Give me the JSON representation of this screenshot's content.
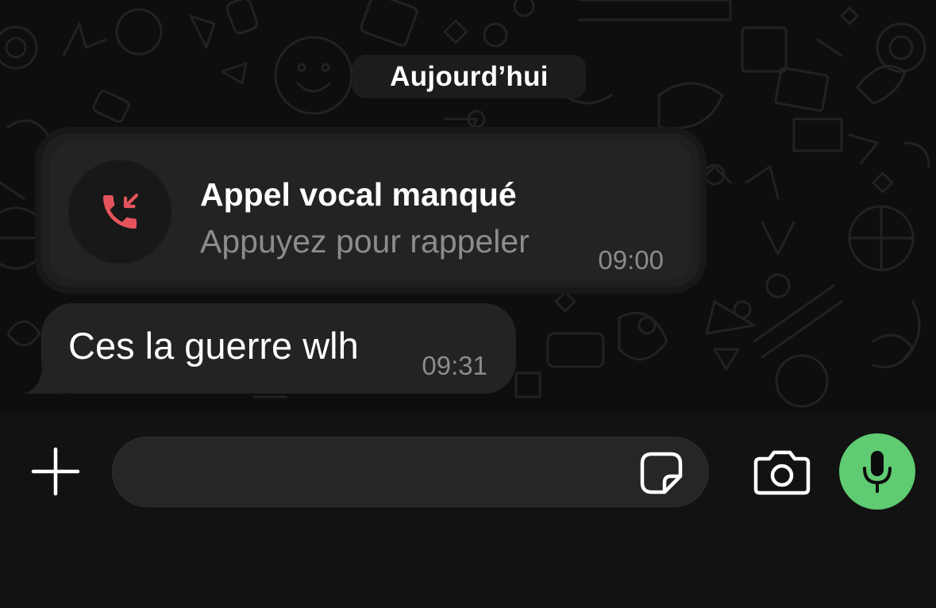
{
  "date_chip": {
    "label": "Aujourd’hui"
  },
  "missed_call": {
    "title": "Appel vocal manqué",
    "subtitle": "Appuyez pour rappeler",
    "time": "09:00",
    "icon": "missed-call-icon",
    "icon_color": "#e5545c"
  },
  "message": {
    "text": "Ces la guerre wlh",
    "time": "09:31"
  },
  "composer": {
    "input_value": "",
    "input_placeholder": "",
    "plus_icon": "plus-icon",
    "sticker_icon": "sticker-icon",
    "camera_icon": "camera-icon",
    "mic_icon": "microphone-icon",
    "mic_color": "#5fcb72"
  }
}
